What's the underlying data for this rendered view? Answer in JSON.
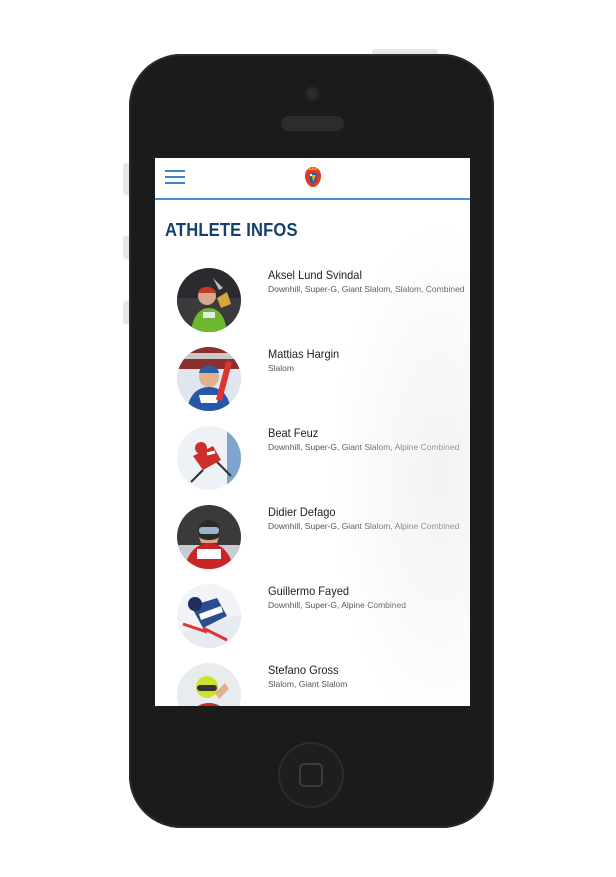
{
  "header": {
    "menu_icon": "hamburger-menu-icon",
    "logo_icon": "rooster-crest-logo",
    "accent_color": "#4b8fc9"
  },
  "page": {
    "title": "ATHLETE INFOS",
    "title_color": "#163f6b"
  },
  "athletes": [
    {
      "name": "Aksel Lund Svindal",
      "disciplines": "Downhill, Super-G, Giant Slalom, Slalom, Combined"
    },
    {
      "name": "Mattias Hargin",
      "disciplines": "Slalom"
    },
    {
      "name": "Beat Feuz",
      "disciplines": "Downhill, Super-G, Giant Slalom, Alpine Combined"
    },
    {
      "name": "Didier Defago",
      "disciplines": "Downhill, Super-G, Giant Slalom, Alpine Combined"
    },
    {
      "name": "Guillermo Fayed",
      "disciplines": "Downhill, Super-G, Alpine Combined"
    },
    {
      "name": "Stefano Gross",
      "disciplines": "Slalom, Giant Slalom"
    }
  ]
}
